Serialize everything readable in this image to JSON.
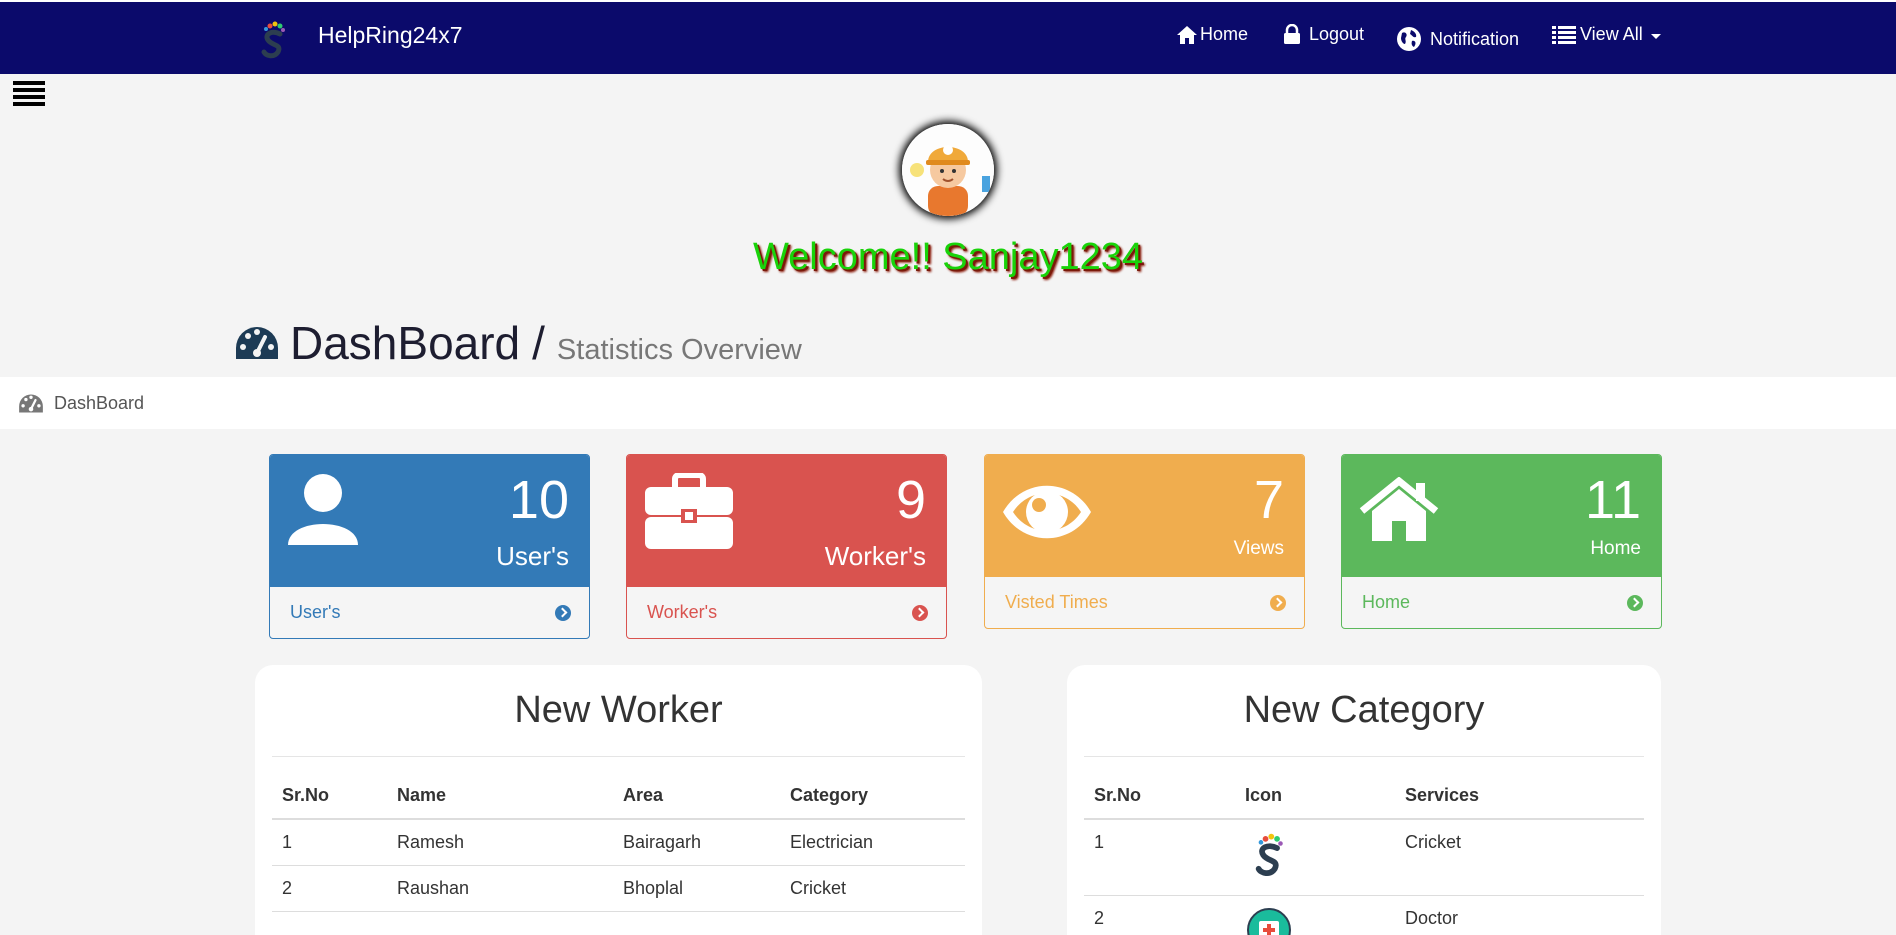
{
  "navbar": {
    "brand": "HelpRing24x7",
    "links": {
      "home": "Home",
      "logout": "Logout",
      "notification": "Notification",
      "view_all": "View All"
    },
    "bg_color": "#0b0a6b"
  },
  "welcome": "Welcome!! Sanjay1234",
  "page": {
    "title": "DashBoard",
    "separator": "/",
    "subtitle": "Statistics Overview"
  },
  "breadcrumb": {
    "label": "DashBoard"
  },
  "cards": {
    "users": {
      "count": "10",
      "label": "User's",
      "footer": "User's",
      "color": "#337ab7",
      "icon": "user-icon"
    },
    "workers": {
      "count": "9",
      "label": "Worker's",
      "footer": "Worker's",
      "color": "#d9534f",
      "icon": "briefcase-icon"
    },
    "views": {
      "count": "7",
      "label": "Views",
      "footer": "Visted Times",
      "color": "#f0ad4e",
      "icon": "eye-icon"
    },
    "home": {
      "count": "11",
      "label": "Home",
      "footer": "Home",
      "color": "#5cb85c",
      "icon": "home-icon"
    }
  },
  "new_worker": {
    "title": "New Worker",
    "headers": [
      "Sr.No",
      "Name",
      "Area",
      "Category"
    ],
    "rows": [
      [
        "1",
        "Ramesh",
        "Bairagarh",
        "Electrician"
      ],
      [
        "2",
        "Raushan",
        "Bhoplal",
        "Cricket"
      ]
    ]
  },
  "new_category": {
    "title": "New Category",
    "headers": [
      "Sr.No",
      "Icon",
      "Services"
    ],
    "rows": [
      {
        "sr": "1",
        "icon": "brand-s-logo-icon",
        "service": "Cricket"
      },
      {
        "sr": "2",
        "icon": "doctor-kit-icon",
        "service": "Doctor"
      }
    ]
  }
}
